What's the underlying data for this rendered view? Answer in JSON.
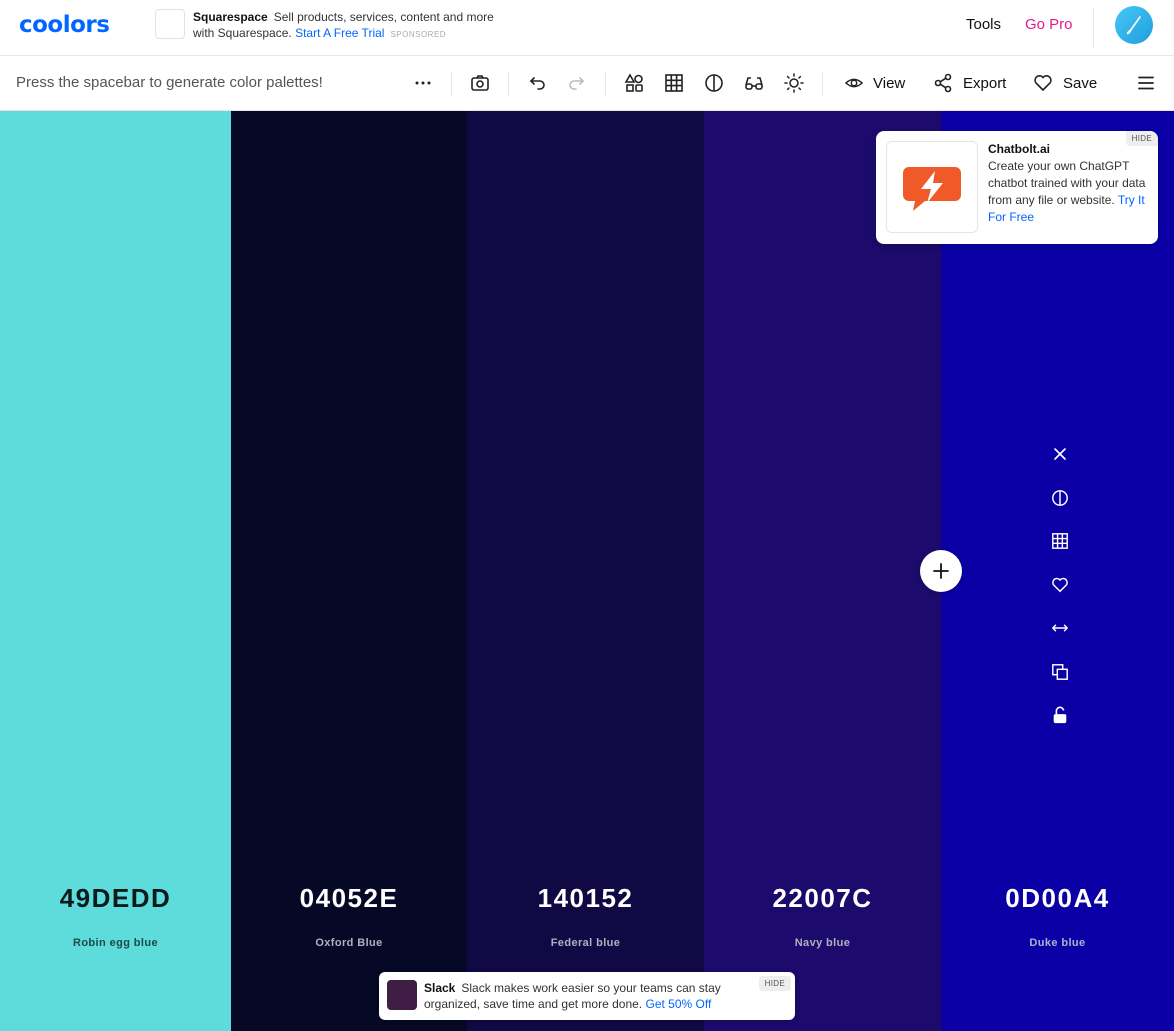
{
  "app": {
    "logo": "coolors"
  },
  "top_ad": {
    "brand": "Squarespace",
    "text": "Sell products, services, content and more with Squarespace.",
    "link": "Start A Free Trial",
    "sponsored": "SPONSORED"
  },
  "nav": {
    "tools": "Tools",
    "go_pro": "Go Pro"
  },
  "toolbar": {
    "hint": "Press the spacebar to generate color palettes!",
    "view_label": "View",
    "export_label": "Export",
    "save_label": "Save"
  },
  "palette": [
    {
      "hex": "49DEDD",
      "name": "Robin egg blue",
      "bg": "#5ddcdb",
      "text_color": "#0b1a1a",
      "name_color": "#1d4a4a"
    },
    {
      "hex": "04052E",
      "name": "Oxford Blue",
      "bg": "#060926",
      "text_color": "#ffffff",
      "name_color": "#b0b0c0"
    },
    {
      "hex": "140152",
      "name": "Federal blue",
      "bg": "#110944",
      "text_color": "#ffffff",
      "name_color": "#b0b0c0"
    },
    {
      "hex": "22007C",
      "name": "Navy blue",
      "bg": "#1c0b6c",
      "text_color": "#ffffff",
      "name_color": "#b0b0c0"
    },
    {
      "hex": "0D00A4",
      "name": "Duke blue",
      "bg": "#0a00a6",
      "text_color": "#ffffff",
      "name_color": "#b0b0d0"
    }
  ],
  "side_ad": {
    "brand": "Chatbolt.ai",
    "text": "Create your own ChatGPT chatbot trained with your data from any file or website.",
    "link": "Try It For Free",
    "hide": "HIDE",
    "accent": "#f05a28"
  },
  "bottom_ad": {
    "brand": "Slack",
    "text": "Slack makes work easier so your teams can stay organized, save time and get more done.",
    "link": "Get 50% Off",
    "hide": "HIDE"
  }
}
